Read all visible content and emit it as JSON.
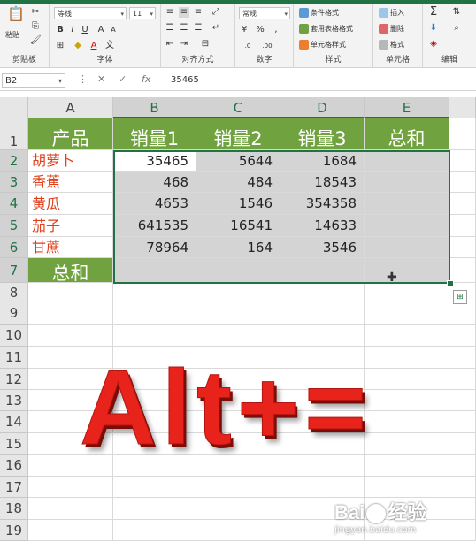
{
  "ribbon": {
    "clipboard": {
      "paste": "粘贴",
      "label": "剪贴板"
    },
    "font": {
      "name": "等线",
      "size": "11",
      "label": "字体",
      "bold": "B",
      "italic": "I",
      "underline": "U"
    },
    "align": {
      "label": "对齐方式"
    },
    "number": {
      "format": "常规",
      "label": "数字",
      "percent": "%",
      "comma": ","
    },
    "styles": {
      "conditional": "条件格式",
      "table": "套用表格格式",
      "cell": "单元格样式",
      "label": "样式"
    },
    "cells": {
      "insert": "插入",
      "delete": "删除",
      "format": "格式",
      "label": "单元格"
    },
    "editing": {
      "sum": "Σ",
      "label": "编辑"
    }
  },
  "formula_bar": {
    "name_box": "B2",
    "fx": "fx",
    "formula": "35465"
  },
  "columns": [
    "A",
    "B",
    "C",
    "D",
    "E"
  ],
  "rows": [
    "1",
    "2",
    "3",
    "4",
    "5",
    "6",
    "7",
    "8",
    "9",
    "10",
    "11",
    "12",
    "13",
    "14",
    "15",
    "16",
    "17",
    "18",
    "19"
  ],
  "table": {
    "headers": [
      "产品",
      "销量1",
      "销量2",
      "销量3",
      "总和"
    ],
    "products": [
      "胡萝卜",
      "香蕉",
      "黄瓜",
      "茄子",
      "甘蔗"
    ],
    "values": [
      [
        "35465",
        "5644",
        "1684"
      ],
      [
        "468",
        "484",
        "18543"
      ],
      [
        "4653",
        "1546",
        "354358"
      ],
      [
        "641535",
        "16541",
        "14633"
      ],
      [
        "78964",
        "164",
        "3546"
      ]
    ],
    "total_label": "总和"
  },
  "overlay_text": "Alt+=",
  "watermark": {
    "brand_left": "Bai",
    "brand_right": "经验",
    "url": "jingyan.baidu.com"
  },
  "colors": {
    "header_green": "#70a33f",
    "excel_green": "#217346",
    "product_red": "#e0401c",
    "overlay_red": "#e8231b"
  }
}
